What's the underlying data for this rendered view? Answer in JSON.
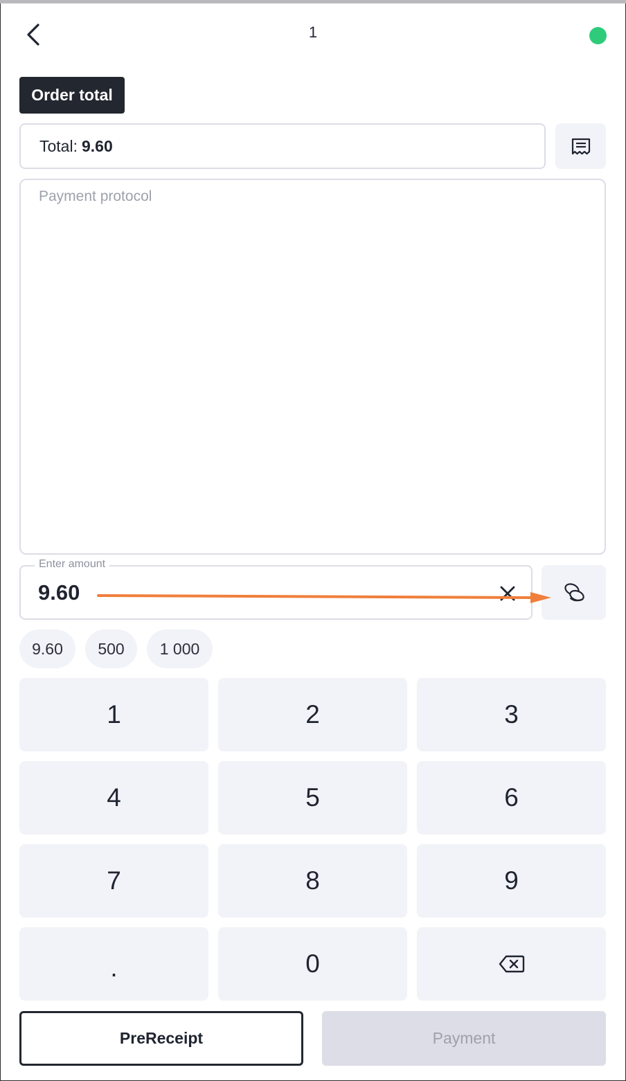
{
  "header": {
    "title": "1",
    "back_icon": "chevron-left-icon",
    "status_color": "#2ecc7a"
  },
  "order": {
    "badge_label": "Order total",
    "total_label": "Total:",
    "total_value": "9.60",
    "receipt_icon": "receipt-icon"
  },
  "protocol": {
    "placeholder": "Payment protocol"
  },
  "amount": {
    "legend": "Enter amount",
    "value": "9.60",
    "clear_icon": "close-icon",
    "coins_icon": "coins-icon"
  },
  "quick_amounts": [
    "9.60",
    "500",
    "1 000"
  ],
  "keypad": [
    "1",
    "2",
    "3",
    "4",
    "5",
    "6",
    "7",
    "8",
    "9",
    ".",
    "0",
    "backspace"
  ],
  "actions": {
    "prereceipt_label": "PreReceipt",
    "payment_label": "Payment"
  },
  "colors": {
    "accent_dark": "#23272f",
    "surface": "#f2f3f8",
    "annotation_arrow": "#f07f3c"
  }
}
